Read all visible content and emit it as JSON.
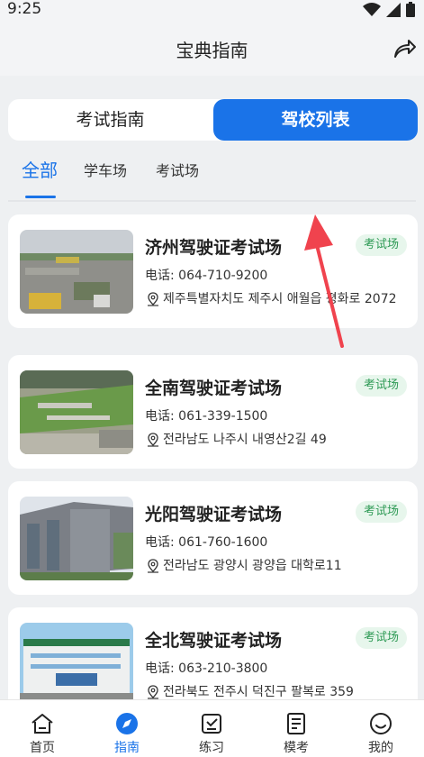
{
  "status": {
    "time": "9:25"
  },
  "header": {
    "title": "宝典指南"
  },
  "segments": {
    "left": "考试指南",
    "right": "驾校列表"
  },
  "filters": [
    "全部",
    "学车场",
    "考试场"
  ],
  "schools": [
    {
      "name": "济州驾驶证考试场",
      "badge": "考试场",
      "phone": "电话: 064-710-9200",
      "address": "제주특별자치도 제주시 애월읍 평화로 2072"
    },
    {
      "name": "全南驾驶证考试场",
      "badge": "考试场",
      "phone": "电话: 061-339-1500",
      "address": "전라남도 나주시 내영산2길 49"
    },
    {
      "name": "光阳驾驶证考试场",
      "badge": "考试场",
      "phone": "电话: 061-760-1600",
      "address": "전라남도 광양시 광양읍 대학로11"
    },
    {
      "name": "全北驾驶证考试场",
      "badge": "考试场",
      "phone": "电话: 063-210-3800",
      "address": "전라북도 전주시 덕진구 팔복로 359"
    }
  ],
  "tabs": [
    {
      "label": "首页",
      "icon": "home-icon"
    },
    {
      "label": "指南",
      "icon": "compass-icon"
    },
    {
      "label": "练习",
      "icon": "practice-icon"
    },
    {
      "label": "模考",
      "icon": "exam-icon"
    },
    {
      "label": "我的",
      "icon": "profile-icon"
    }
  ],
  "colors": {
    "accent": "#1a73e8",
    "badge_bg": "#e7f6ec",
    "badge_text": "#2e9a55",
    "arrow": "#f0434e"
  }
}
